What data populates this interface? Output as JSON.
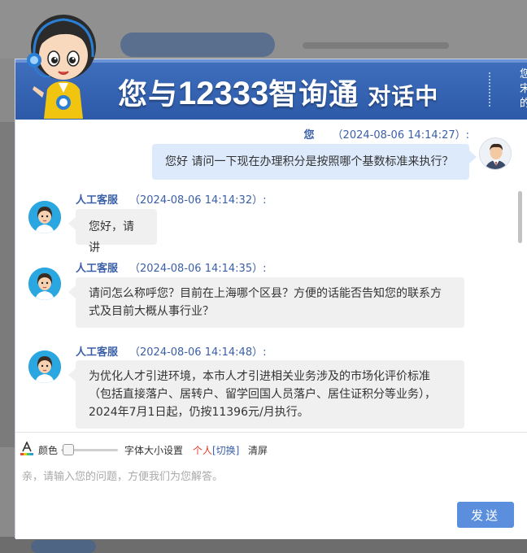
{
  "header": {
    "title_prefix": "您与",
    "title_number": "12333",
    "title_brand": "智询通",
    "title_suffix": "对话中",
    "side_text": "您宋的"
  },
  "messages": [
    {
      "sender": "您",
      "timestamp": "（2024-08-06 14:14:27）:",
      "text": "您好 请问一下现在办理积分是按照哪个基数标准来执行？"
    },
    {
      "sender": "人工客服",
      "timestamp": "（2024-08-06 14:14:32）:",
      "text": "您好，请讲"
    },
    {
      "sender": "人工客服",
      "timestamp": "（2024-08-06 14:14:35）:",
      "text": "请问怎么称呼您？目前在上海哪个区县？方便的话能否告知您的联系方式及目前大概从事行业？"
    },
    {
      "sender": "人工客服",
      "timestamp": "（2024-08-06 14:14:48）:",
      "text": "为优化人才引进环境，本市人才引进相关业务涉及的市场化评价标准（包括直接落户、居转户、留学回国人员落户、居住证积分等业务），2024年7月1日起，仍按11396元/月执行。"
    }
  ],
  "toolbar": {
    "color_label": "颜色",
    "font_size_label": "字体大小设置",
    "personal_label": "个人",
    "switch_label": "[切换]",
    "clear_label": "清屏"
  },
  "input": {
    "placeholder": "亲，请输入您的问题，方便我们为您解答。",
    "value": ""
  },
  "send_label": "发送",
  "colors": {
    "header_blue": "#2d5aa8",
    "user_bubble": "#dceafb",
    "agent_bubble": "#f0f0f0",
    "send_button": "#5b8fde",
    "accent_red": "#e03b2c"
  }
}
